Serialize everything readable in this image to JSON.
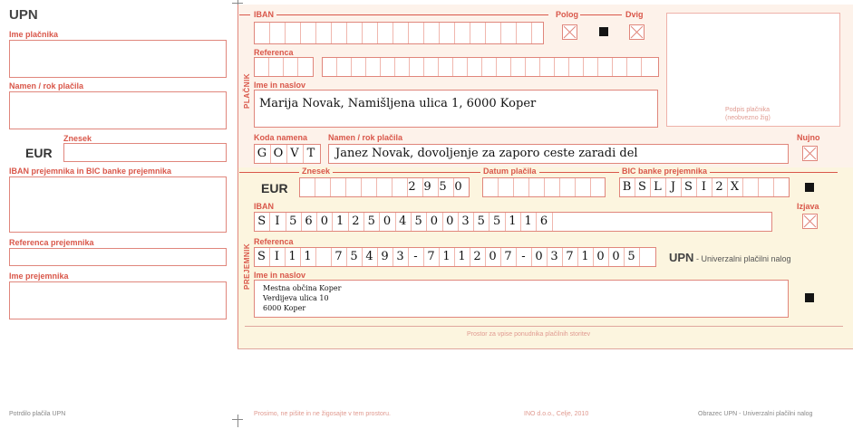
{
  "form_code": "UPN",
  "stub": {
    "payer_name_label": "Ime plačnika",
    "purpose_label": "Namen / rok plačila",
    "amount_label": "Znesek",
    "currency": "EUR",
    "iban_label": "IBAN prejemnika in BIC banke prejemnika",
    "reference_label": "Referenca prejemnika",
    "recipient_label": "Ime prejemnika",
    "footer": "Potrdilo plačila UPN"
  },
  "payer": {
    "section_label": "PLAČNIK",
    "iban_label": "IBAN",
    "pologue_label": "Polog",
    "dvig_label": "Dvig",
    "reference_label": "Referenca",
    "name_label": "Ime in naslov",
    "name_value": "Marija Novak, Namišljena ulica 1, 6000 Koper",
    "signature_label_1": "Podpis plačnika",
    "signature_label_2": "(neobvezno žig)"
  },
  "purpose": {
    "code_label": "Koda namena",
    "code_chars": [
      "G",
      "O",
      "V",
      "T"
    ],
    "purpose_label": "Namen / rok plačila",
    "purpose_value": "Janez Novak, dovoljenje za zaporo ceste zaradi del",
    "urgent_label": "Nujno"
  },
  "amount": {
    "label": "Znesek",
    "currency": "EUR",
    "digits": [
      "2",
      "9",
      "5",
      "0"
    ],
    "date_label": "Datum plačila",
    "bic_label": "BIC banke prejemnika",
    "bic_chars": [
      "B",
      "S",
      "L",
      "J",
      "S",
      "I",
      "2",
      "X"
    ]
  },
  "recipient": {
    "section_label": "PREJEMNIK",
    "iban_label": "IBAN",
    "iban_chars": [
      "S",
      "I",
      "5",
      "6",
      "0",
      "1",
      "2",
      "5",
      "0",
      "4",
      "5",
      "0",
      "0",
      "3",
      "5",
      "5",
      "1",
      "1",
      "6"
    ],
    "statement_label": "Izjava",
    "reference_label": "Referenca",
    "reference_chars": [
      "S",
      "I",
      "1",
      "1",
      "7",
      "5",
      "4",
      "9",
      "3",
      "-",
      "7",
      "1",
      "1",
      "2",
      "0",
      "7",
      "-",
      "0",
      "3",
      "7",
      "1",
      "0",
      "0",
      "5"
    ],
    "upn_title": "UPN",
    "upn_subtitle": " - Univerzalni plačilni nalog",
    "name_label": "Ime in naslov",
    "name_lines": [
      "Mestna občina Koper",
      "Verdijeva ulica 10",
      "6000 Koper"
    ],
    "provider_space": "Prostor za vpise ponudnika plačilnih storitev"
  },
  "footer": {
    "notice": "Prosimo, ne pišite in ne žigosajte v tem prostoru.",
    "printer": "INO d.o.o., Celje, 2010",
    "form_name": "Obrazec UPN - Univerzalni plačilni nalog"
  }
}
